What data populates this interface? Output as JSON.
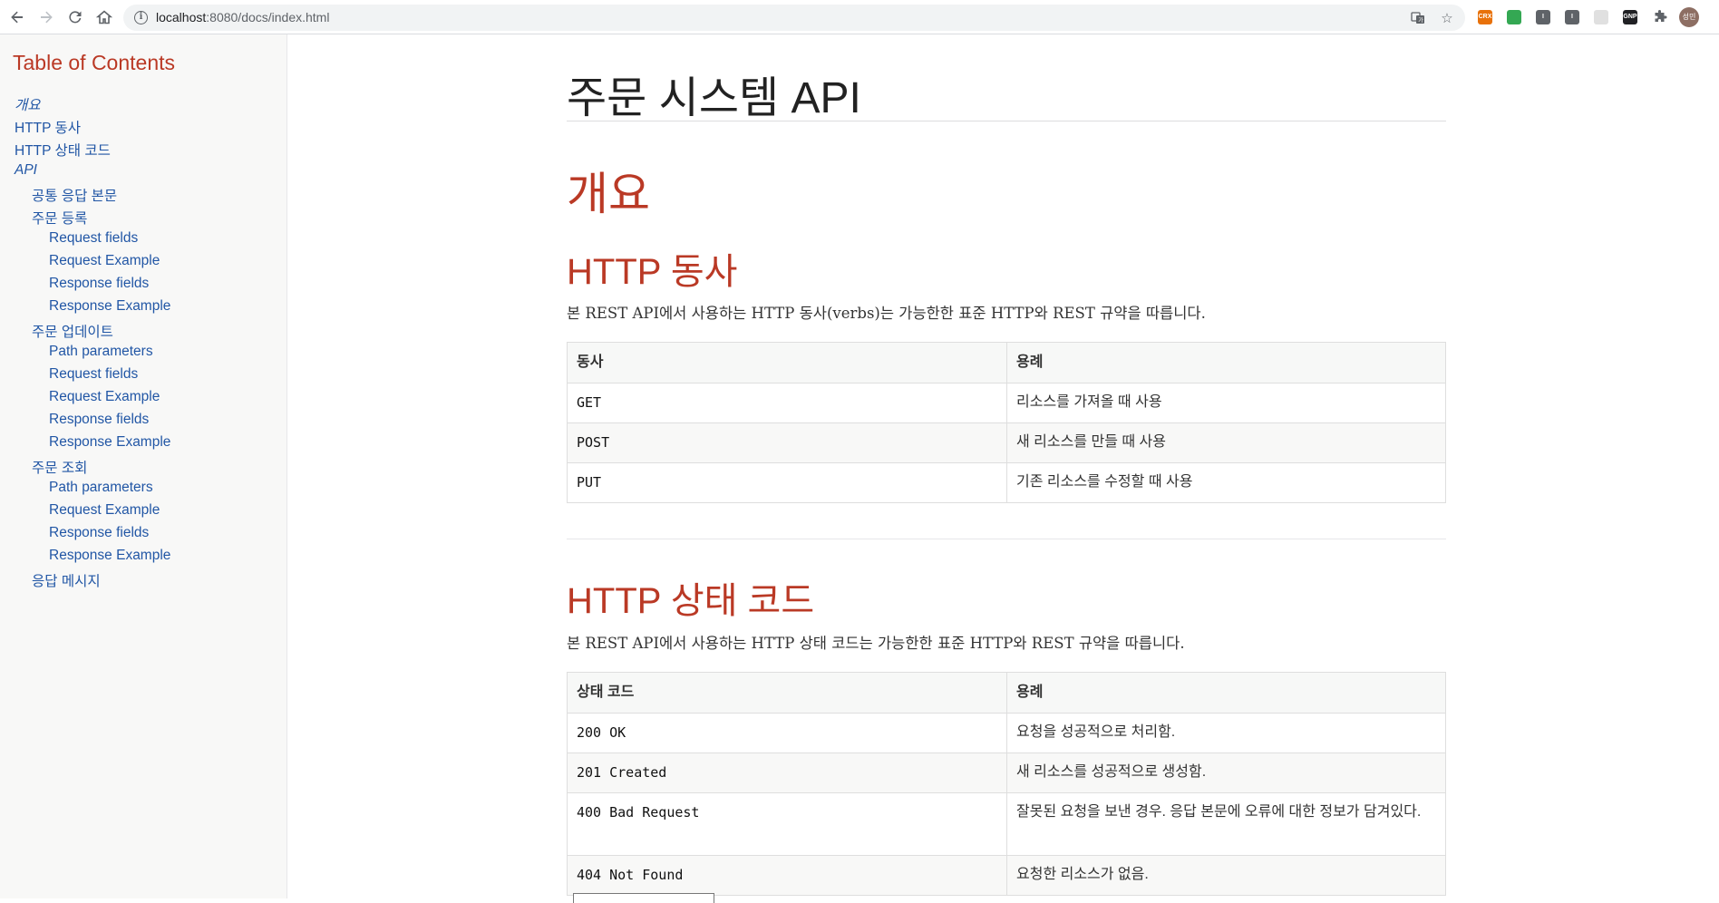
{
  "browser": {
    "url_host": "localhost",
    "url_rest": ":8080/docs/index.html",
    "extensions": [
      {
        "name": "ext-orange",
        "label": "CRX",
        "color": "#e8710a"
      },
      {
        "name": "ext-green",
        "label": "",
        "color": "#34a853"
      },
      {
        "name": "ext-gray-1",
        "label": "I",
        "color": "#5f6368"
      },
      {
        "name": "ext-gray-2",
        "label": "I",
        "color": "#5f6368"
      },
      {
        "name": "ext-calendar",
        "label": "",
        "color": "#e0e0e0"
      },
      {
        "name": "ext-gnp",
        "label": "GNP",
        "color": "#202124"
      }
    ],
    "profile_label": "성민"
  },
  "toc": {
    "title": "Table of Contents",
    "items": [
      {
        "label": "개요",
        "level": 1,
        "em": true
      },
      {
        "label": "HTTP 동사",
        "level": 1
      },
      {
        "label": "HTTP 상태 코드",
        "level": 1
      },
      {
        "label": "API",
        "level": 1,
        "em": true
      },
      {
        "label": "공통 응답 본문",
        "level": 2
      },
      {
        "label": "주문 등록",
        "level": 2
      },
      {
        "label": "Request fields",
        "level": 3
      },
      {
        "label": "Request Example",
        "level": 3
      },
      {
        "label": "Response fields",
        "level": 3
      },
      {
        "label": "Response Example",
        "level": 3
      },
      {
        "label": "주문 업데이트",
        "level": 2
      },
      {
        "label": "Path parameters",
        "level": 3
      },
      {
        "label": "Request fields",
        "level": 3
      },
      {
        "label": "Request Example",
        "level": 3
      },
      {
        "label": "Response fields",
        "level": 3
      },
      {
        "label": "Response Example",
        "level": 3
      },
      {
        "label": "주문 조회",
        "level": 2
      },
      {
        "label": "Path parameters",
        "level": 3
      },
      {
        "label": "Request Example",
        "level": 3
      },
      {
        "label": "Response fields",
        "level": 3
      },
      {
        "label": "Response Example",
        "level": 3
      },
      {
        "label": "응답 메시지",
        "level": 2
      }
    ]
  },
  "doc": {
    "title": "주문 시스템 API",
    "overview_heading": "개요",
    "verbs": {
      "heading": "HTTP 동사",
      "intro": "본 REST API에서 사용하는 HTTP 동사(verbs)는 가능한한 표준 HTTP와 REST 규약을 따릅니다.",
      "headers": [
        "동사",
        "용례"
      ],
      "rows": [
        [
          "GET",
          "리소스를 가져올 때 사용"
        ],
        [
          "POST",
          "새 리소스를 만들 때 사용"
        ],
        [
          "PUT",
          "기존 리소스를 수정할 때 사용"
        ]
      ]
    },
    "status": {
      "heading": "HTTP 상태 코드",
      "intro": "본 REST API에서 사용하는 HTTP 상태 코드는 가능한한 표준 HTTP와 REST 규약을 따릅니다.",
      "headers": [
        "상태 코드",
        "용례"
      ],
      "rows": [
        [
          "200 OK",
          "요청을 성공적으로 처리함."
        ],
        [
          "201 Created",
          "새 리소스를 성공적으로 생성함."
        ],
        [
          "400 Bad Request",
          "잘못된 요청을 보낸 경우. 응답 본문에 오류에 대한 정보가 담겨있다."
        ],
        [
          "404 Not Found",
          "요청한 리소스가 없음."
        ]
      ]
    }
  }
}
